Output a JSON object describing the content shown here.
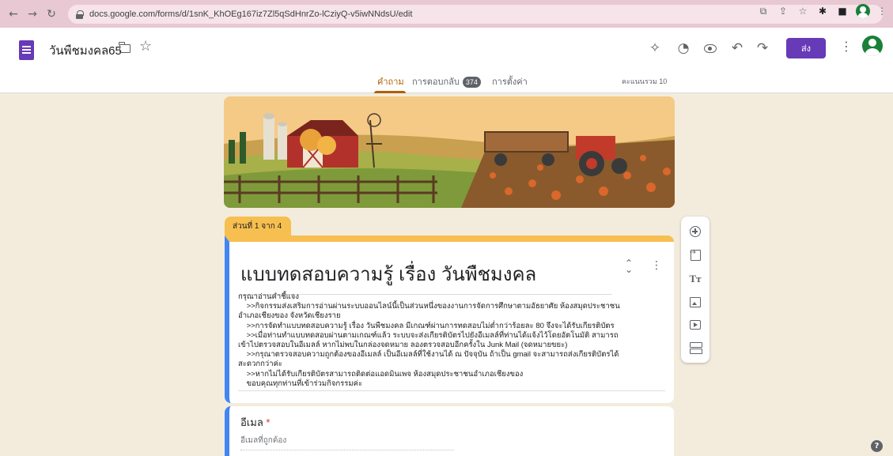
{
  "browser": {
    "url": "docs.google.com/forms/d/1snK_KhOEg167iz7Zl5qSdHnrZo-lCziyQ-v5iwNNdsU/edit"
  },
  "header": {
    "title": "วันพืชมงคล65",
    "send_label": "ส่ง"
  },
  "tabs": {
    "questions": "คำถาม",
    "responses": "การตอบกลับ",
    "responses_count": "374",
    "settings": "การตั้งค่า",
    "total_points": "คะแนนรวม 10"
  },
  "section": {
    "label": "ส่วนที่ 1 จาก 4"
  },
  "form": {
    "title": "แบบทดสอบความรู้ เรื่อง วันพืชมงคล",
    "description": [
      "กรุณาอ่านคำชี้แจง",
      "    >>กิจกรรมส่งเสริมการอ่านผ่านระบบออนไลน์นี้เป็นส่วนหนึ่งของงานการจัดการศึกษาตามอัธยาศัย ห้องสมุดประชาชน",
      "อำเภอเชียงของ จังหวัดเชียงราย",
      "    >>การจัดทำแบบทดสอบความรู้ เรื่อง วันพืชมงคล มีเกณฑ์ผ่านการทดสอบไม่ต่ำกว่าร้อยละ 80 จึงจะได้รับเกียรติบัตร",
      "    >>เมื่อท่านทำแบบทดสอบผ่านตามเกณฑ์แล้ว ระบบจะส่งเกียรติบัตรไปยังอีเมลล์ที่ท่านได้แจ้งไว้โดยอัตโนมัติ สามารถ",
      "เข้าไปตรวจสอบในอีเมลล์ หากไม่พบในกล่องจดหมาย ลองตรวจสอบอีกครั้งใน Junk Mail (จดหมายขยะ)",
      "    >>กรุณาตรวจสอบความถูกต้องของอีเมลล์ เป็นอีเมลล์ที่ใช้งานได้ ณ ปัจจุบัน ถ้าเป็น gmail จะสามารถส่งเกียรติบัตรได้",
      "สะดวกกว่าค่ะ",
      "    >>หากไม่ได้รับเกียรติบัตรสามารถติดต่อแอดมินเพจ ห้องสมุดประชาชนอำเภอเชียงของ",
      "    ขอบคุณทุกท่านที่เข้าร่วมกิจกรรมค่ะ"
    ]
  },
  "email_question": {
    "label": "อีเมล",
    "required_mark": "*",
    "placeholder": "อีเมลที่ถูกต้อง"
  },
  "icons": {
    "toolbar": [
      "add-question-icon",
      "import-questions-icon",
      "add-title-icon",
      "add-image-icon",
      "add-video-icon",
      "add-section-icon"
    ],
    "header": [
      "customize-theme-icon",
      "palette-icon",
      "preview-eye-icon",
      "undo-icon",
      "redo-icon"
    ]
  },
  "colors": {
    "accent": "#673ab7",
    "theme": "#f6bf4f",
    "tab_active": "#b06000",
    "background": "#f3ecdd"
  }
}
